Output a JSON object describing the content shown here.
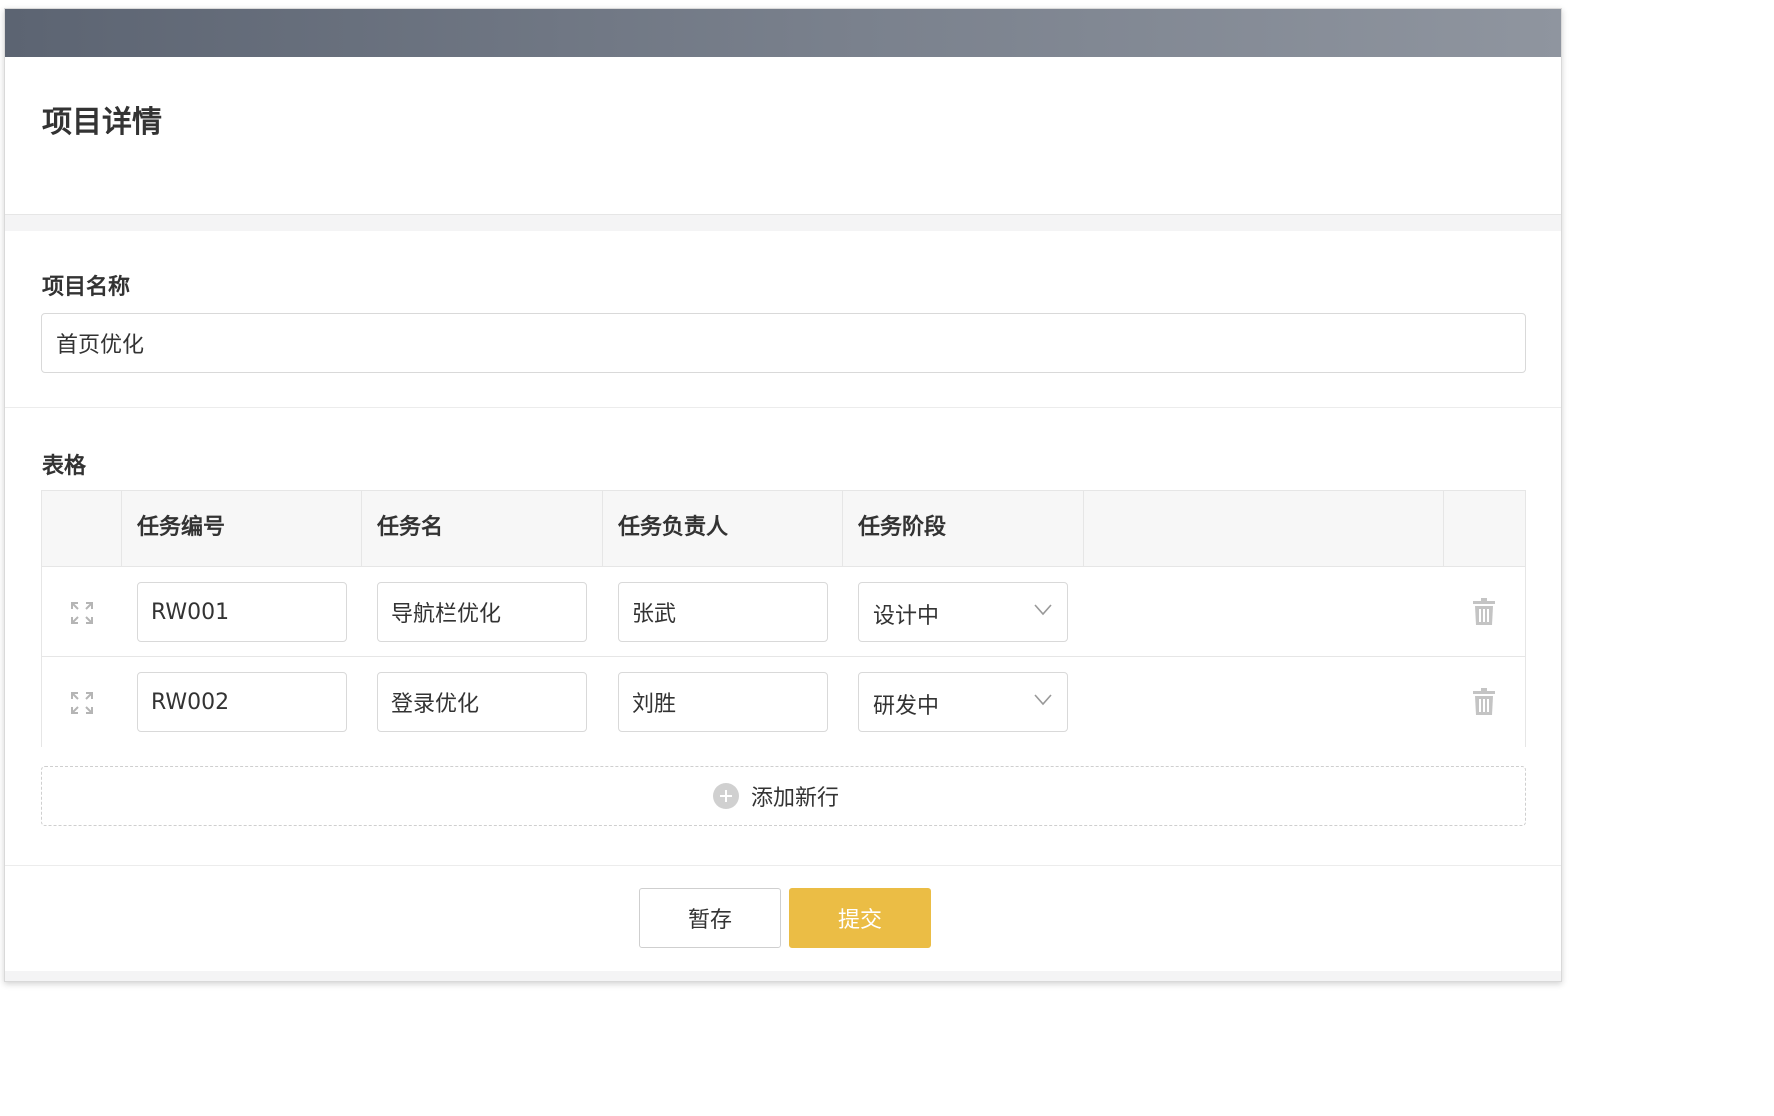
{
  "page": {
    "title": "项目详情"
  },
  "form": {
    "project_name_label": "项目名称",
    "project_name_value": "首页优化",
    "table_label": "表格"
  },
  "table": {
    "headers": [
      "任务编号",
      "任务名",
      "任务负责人",
      "任务阶段"
    ],
    "rows": [
      {
        "id": "RW001",
        "name": "导航栏优化",
        "owner": "张武",
        "stage": "设计中"
      },
      {
        "id": "RW002",
        "name": "登录优化",
        "owner": "刘胜",
        "stage": "研发中"
      }
    ],
    "add_row_label": "添加新行"
  },
  "footer": {
    "save_label": "暂存",
    "submit_label": "提交"
  },
  "colors": {
    "accent": "#ebbd45",
    "titlebar": "#6b7280",
    "border": "#d9d9d9"
  },
  "icons": {
    "drag": "expand-arrows-icon",
    "delete": "trash-icon",
    "add": "plus-circle-icon",
    "select": "chevron-down-icon"
  }
}
